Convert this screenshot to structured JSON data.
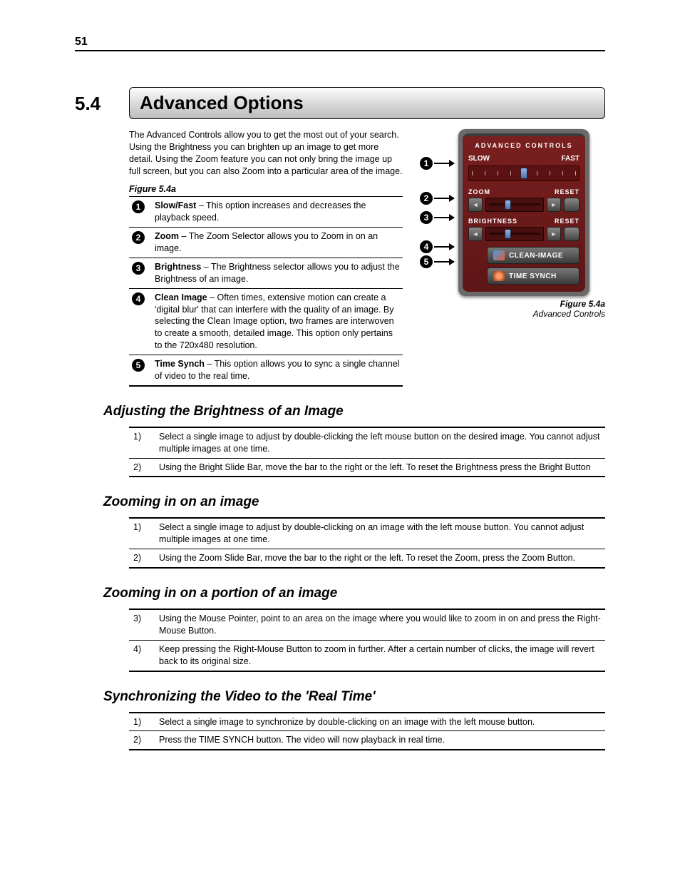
{
  "page_number": "51",
  "section_number": "5.4",
  "section_title": "Advanced Options",
  "intro": "The Advanced Controls allow you to get the most out of your search. Using the Brightness you can brighten up an image to get more detail. Using the Zoom feature you can not only bring the image up full screen, but you can also Zoom into a particular area of the image.",
  "figure_label": "Figure 5.4a",
  "desc_rows": [
    {
      "n": "1",
      "term": "Slow/Fast",
      "text": " – This option increases and decreases the playback speed."
    },
    {
      "n": "2",
      "term": "Zoom",
      "text": " – The Zoom Selector allows you to Zoom in on an image."
    },
    {
      "n": "3",
      "term": "Brightness",
      "text": " – The Brightness selector allows you to adjust the Brightness of an image."
    },
    {
      "n": "4",
      "term": "Clean Image",
      "text": " – Often times, extensive motion can create a 'digital blur' that can interfere with the quality of an image. By selecting the Clean Image option, two frames are interwoven to create a smooth, detailed image. This option only pertains to the 720x480 resolution."
    },
    {
      "n": "5",
      "term": "Time Synch",
      "text": " – This option allows you to sync a single channel of video to the real time."
    }
  ],
  "panel": {
    "title": "ADVANCED CONTROLS",
    "slow": "SLOW",
    "fast": "FAST",
    "zoom": "ZOOM",
    "reset": "RESET",
    "brightness": "BRIGHTNESS",
    "clean": "CLEAN-IMAGE",
    "time": "TIME SYNCH"
  },
  "fig_caption_bold": "Figure 5.4a",
  "fig_caption_italic": "Advanced Controls",
  "sub1": {
    "title": "Adjusting the Brightness of an Image",
    "steps": [
      {
        "n": "1)",
        "t": "Select a single image to adjust by double-clicking the left mouse button on the desired image. You cannot adjust multiple images at one time."
      },
      {
        "n": "2)",
        "t": "Using the Bright Slide Bar, move the bar to the right or the left. To reset the Brightness press the Bright Button"
      }
    ]
  },
  "sub2": {
    "title": "Zooming in on an image",
    "steps": [
      {
        "n": "1)",
        "t": "Select a single image to adjust by double-clicking on an image with the left mouse button. You cannot adjust multiple images at one time."
      },
      {
        "n": "2)",
        "t": "Using the Zoom Slide Bar, move the bar to the right or the left. To reset the Zoom, press the Zoom Button."
      }
    ]
  },
  "sub3": {
    "title": "Zooming in on a portion of an image",
    "steps": [
      {
        "n": "3)",
        "t": "Using the Mouse Pointer, point to an area on the image where you would like to zoom in on and press the Right-Mouse Button."
      },
      {
        "n": "4)",
        "t": "Keep pressing the Right-Mouse Button to zoom in further. After a certain number of clicks, the image will revert back to its original size."
      }
    ]
  },
  "sub4": {
    "title": "Synchronizing the Video to the 'Real Time'",
    "steps": [
      {
        "n": "1)",
        "t": "Select a single image to synchronize by double-clicking on an image with the left mouse button."
      },
      {
        "n": "2)",
        "t": "Press the TIME SYNCH button. The video will now playback in real time."
      }
    ]
  }
}
